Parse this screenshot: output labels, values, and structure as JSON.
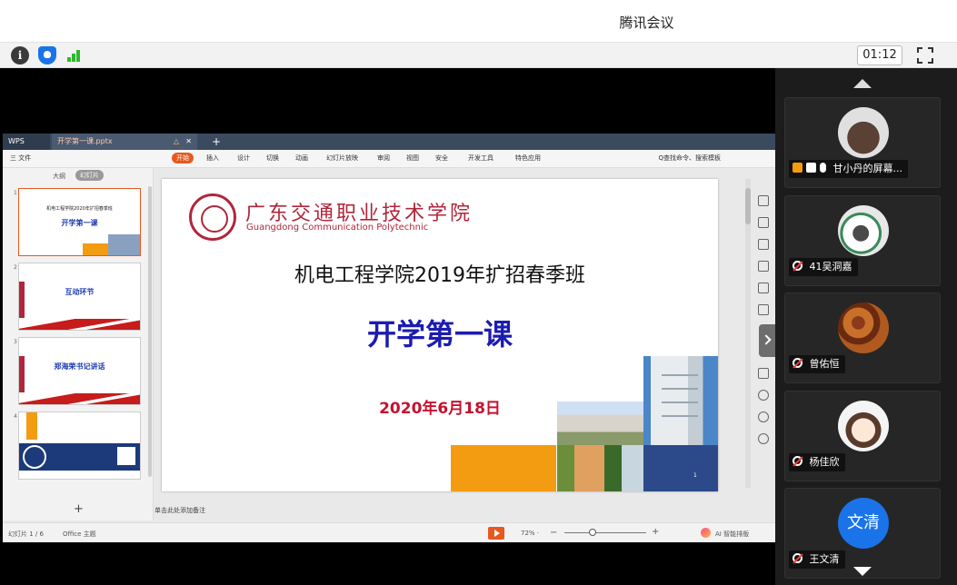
{
  "meeting": {
    "title": "腾讯会议",
    "timer": "01:12",
    "icons": [
      "info-icon",
      "shield-icon",
      "signal-icon",
      "fullscreen-icon"
    ]
  },
  "wps": {
    "app_tab": "WPS",
    "file_tab": "开学第一课.pptx",
    "menu": [
      "三 文件",
      "开始",
      "插入",
      "设计",
      "切换",
      "动画",
      "幻灯片放映",
      "审阅",
      "视图",
      "安全",
      "开发工具",
      "特色应用"
    ],
    "search": "Q查找命令、搜索模板",
    "panel_tabs": [
      "大纲",
      "幻灯片"
    ],
    "thumbs": [
      {
        "num": "1",
        "title": "开学第一课",
        "sub": "机电工程学院2020年扩招春季班"
      },
      {
        "num": "2",
        "title": "互动环节"
      },
      {
        "num": "3",
        "title": "郑海荣书记讲话"
      },
      {
        "num": "4",
        "title": ""
      }
    ],
    "notes_placeholder": "单击此处添加备注",
    "status_left": "幻灯片 1 / 6",
    "theme": "Office 主题",
    "zoom": "72% ·",
    "ai_label": "AI 智能排版"
  },
  "slide": {
    "school_cn": "广东交通职业技术学院",
    "school_en": "Guangdong Communication Polytechnic",
    "subtitle": "机电工程学院2019年扩招春季班",
    "title": "开学第一课",
    "date": "2020年6月18日",
    "page": "1",
    "colors": {
      "title": "#1c1cb0",
      "date": "#c8102e",
      "brand": "#b0263b",
      "orange": "#f39c12",
      "navy": "#2c4a8a"
    }
  },
  "participants": [
    {
      "name": "甘小丹的屏幕...",
      "avatar": "bear",
      "sharing": true
    },
    {
      "name": "41吴洞嘉",
      "avatar": "bird",
      "muted": true
    },
    {
      "name": "曾佑恒",
      "avatar": "food",
      "muted": true
    },
    {
      "name": "杨佳欣",
      "avatar": "girl",
      "muted": true
    },
    {
      "name": "王文清",
      "avatar": "text",
      "avatar_text": "文清",
      "muted": true
    }
  ]
}
